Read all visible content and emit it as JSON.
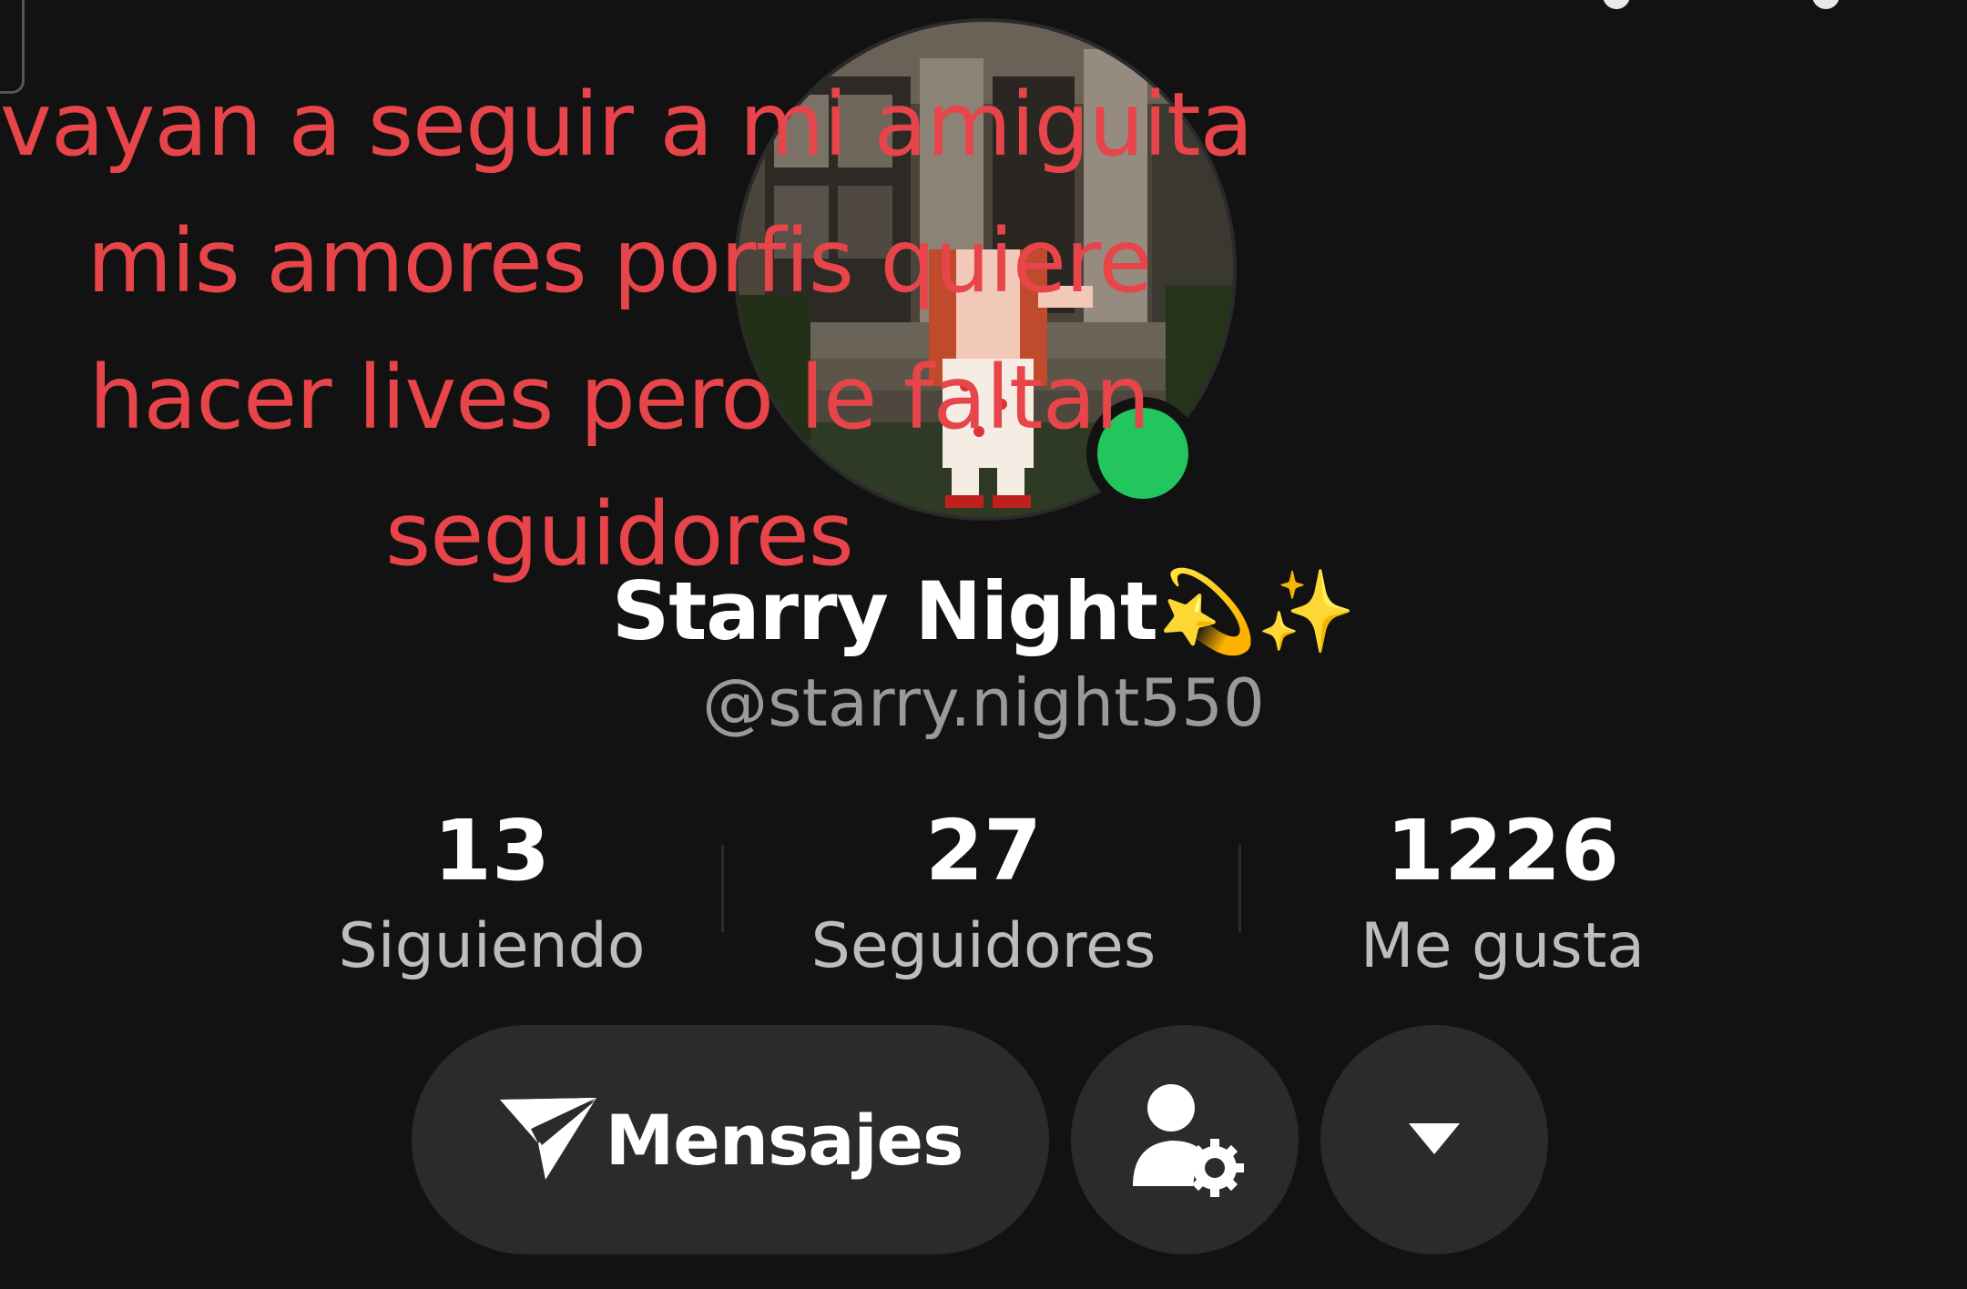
{
  "overlay_caption": {
    "lines": [
      "vayan a seguir a mi amiguita",
      "mis amores porfis quiere",
      "hacer lives pero le faltan",
      "seguidores"
    ],
    "color": "#e8454a"
  },
  "profile": {
    "display_name": "Starry Night",
    "display_name_emoji": "💫✨",
    "username": "@starry.night550",
    "online": true,
    "online_color": "#22c55e"
  },
  "stats": [
    {
      "value": "13",
      "label": "Siguiendo"
    },
    {
      "value": "27",
      "label": "Seguidores"
    },
    {
      "value": "1226",
      "label": "Me gusta"
    }
  ],
  "actions": {
    "messages_label": "Mensajes",
    "messages_icon": "paper-plane-icon",
    "profile_settings_icon": "person-gear-icon",
    "more_icon": "caret-down-icon"
  }
}
